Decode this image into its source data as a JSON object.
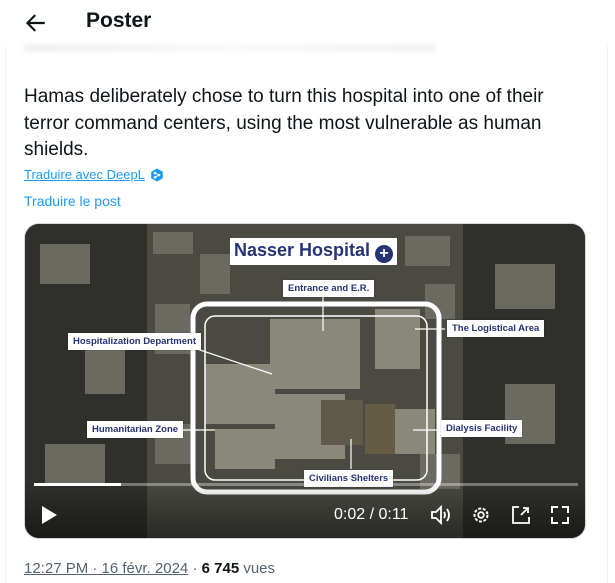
{
  "header": {
    "title": "Poster"
  },
  "tweet": {
    "text": "Hamas deliberately chose to turn this hospital into one of their terror command centers, using the most vulnerable as human shields.",
    "translate_deepl": "Traduire avec DeepL",
    "translate_post": "Traduire le post"
  },
  "video": {
    "title": "Nasser Hospital",
    "labels": {
      "entrance": "Entrance and E.R.",
      "hospitalization": "Hospitalization Department",
      "logistical": "The Logistical Area",
      "humanitarian": "Humanitarian Zone",
      "dialysis": "Dialysis Facility",
      "shelters": "Civilians Shelters"
    },
    "time": "0:02 / 0:11",
    "progress_fraction": 0.16
  },
  "meta": {
    "timestamp": "12:27 PM · 16 févr. 2024",
    "separator": " · ",
    "views_count": "6 745",
    "views_label": "vues"
  },
  "colors": {
    "accent": "#1d9bf0",
    "label_text": "#273374"
  }
}
